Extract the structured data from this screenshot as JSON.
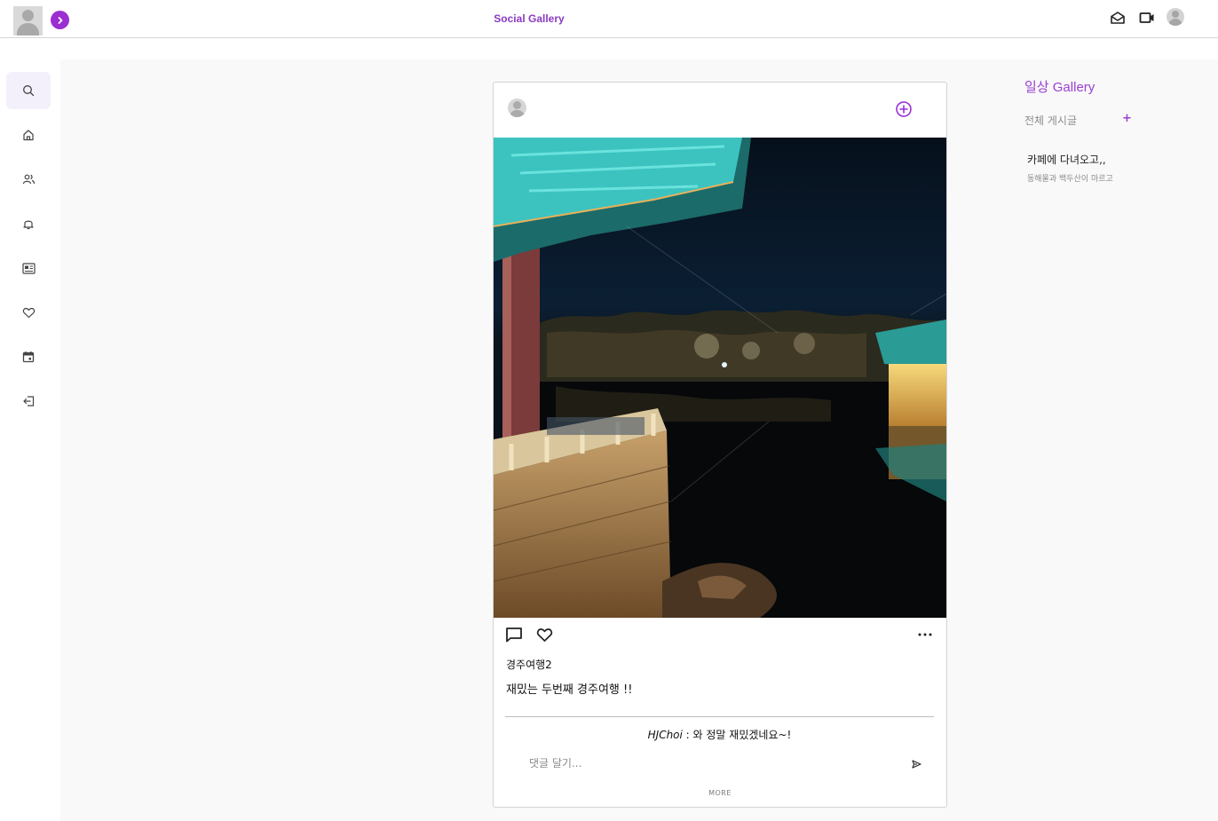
{
  "header": {
    "app_title": "Social Gallery",
    "icons": [
      "drafts-icon",
      "video-icon",
      "account-icon"
    ]
  },
  "leftnav": {
    "items": [
      {
        "name": "search-icon",
        "active": true
      },
      {
        "name": "home-icon",
        "active": false
      },
      {
        "name": "friends-icon",
        "active": false
      },
      {
        "name": "bell-icon",
        "active": false
      },
      {
        "name": "news-icon",
        "active": false
      },
      {
        "name": "heart-icon",
        "active": false
      },
      {
        "name": "calendar-icon",
        "active": false
      },
      {
        "name": "logout-icon",
        "active": false
      }
    ]
  },
  "post": {
    "title": "경주여행2",
    "body": "재밌는 두번째 경주여행 !!",
    "comment_author": "HJChoi",
    "comment_separator": " : ",
    "comment_text": "와 정말 재밌겠네요~!",
    "comment_placeholder": "댓글 달기...",
    "more_label": "MORE"
  },
  "right_panel": {
    "title": "일상 Gallery",
    "all_posts_label": "전체 게시글",
    "add_label": "+",
    "items": [
      {
        "title": "카페에 다녀오고,,",
        "subtitle": "동해물과 백두산이 마르고"
      }
    ]
  },
  "colors": {
    "accent": "#9b2fd1",
    "title": "#8b3bc2",
    "nav_active_bg": "#f3f0fb",
    "main_bg": "#f9f9f9"
  }
}
